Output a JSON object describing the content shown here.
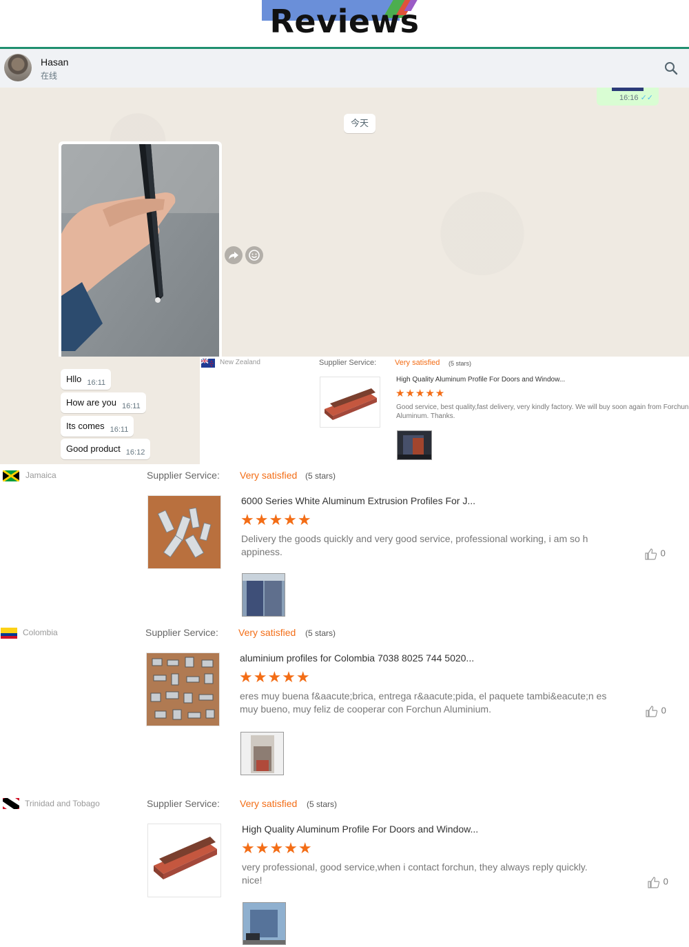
{
  "banner": {
    "title": "Reviews"
  },
  "chat": {
    "contact_name": "Hasan",
    "contact_status": "在线",
    "prev_message_time": "16:16",
    "day_label": "今天",
    "messages": [
      {
        "text": "Hllo",
        "time": "16:11"
      },
      {
        "text": "How are you",
        "time": "16:11"
      },
      {
        "text": "Its comes",
        "time": "16:11"
      },
      {
        "text": "Good product",
        "time": "16:12"
      }
    ]
  },
  "icons": {
    "search": "search-icon",
    "forward": "forward-icon",
    "emoji": "emoji-icon",
    "like": "thumbs-up-icon"
  },
  "colors": {
    "accent": "#f36d16",
    "chat_bg": "#efeae2",
    "banner_line": "#1f8f6f",
    "outgoing_bubble": "#d9fdd3"
  },
  "reviews": [
    {
      "country": "New Zealand",
      "service_label": "Supplier Service:",
      "service_value": "Very satisfied",
      "service_stars": "(5 stars)",
      "product_title": "High Quality Aluminum Profile For Doors and Window...",
      "rating": 5,
      "comment": "Good service, best quality,fast delivery, very kindly factory. We will buy soon again from Forchun Aluminum. Thanks."
    },
    {
      "country": "Jamaica",
      "service_label": "Supplier Service:",
      "service_value": "Very satisfied",
      "service_stars": "(5 stars)",
      "product_title": "6000 Series White Aluminum Extrusion Profiles For J...",
      "rating": 5,
      "comment": "Delivery the goods quickly and very good service, professional working, i am so h appiness.",
      "likes": "0"
    },
    {
      "country": "Colombia",
      "service_label": "Supplier Service:",
      "service_value": "Very satisfied",
      "service_stars": "(5 stars)",
      "product_title": "aluminium profiles for Colombia 7038 8025 744 5020...",
      "rating": 5,
      "comment": "eres muy buena f&aacute;brica, entrega r&aacute;pida, el paquete tambi&eacute;n es muy bueno, muy feliz de cooperar con Forchun Aluminium.",
      "likes": "0"
    },
    {
      "country": "Trinidad and Tobago",
      "service_label": "Supplier Service:",
      "service_value": "Very satisfied",
      "service_stars": "(5 stars)",
      "product_title": "High Quality Aluminum Profile For Doors and Window...",
      "rating": 5,
      "comment": "very professional, good service,when i contact forchun, they always reply quickly. nice!",
      "likes": "0"
    }
  ]
}
